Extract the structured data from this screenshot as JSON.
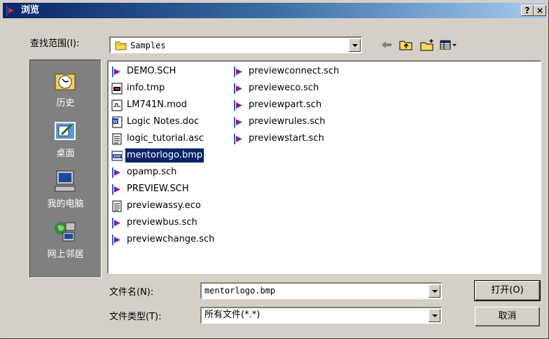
{
  "window": {
    "title": "浏览",
    "help_label": "?",
    "close_label": "×"
  },
  "lookin": {
    "label": "查找范围(I):",
    "value": "Samples"
  },
  "toolbar": [
    "back-icon",
    "up-folder-icon",
    "new-folder-icon",
    "view-menu-icon"
  ],
  "places": [
    {
      "label": "历史",
      "icon": "history-icon"
    },
    {
      "label": "桌面",
      "icon": "desktop-icon"
    },
    {
      "label": "我的电脑",
      "icon": "my-computer-icon"
    },
    {
      "label": "网上邻居",
      "icon": "network-icon"
    }
  ],
  "files": {
    "col1": [
      {
        "name": "DEMO.SCH",
        "icon": "schematic"
      },
      {
        "name": "info.tmp",
        "icon": "tmp"
      },
      {
        "name": "LM741N.mod",
        "icon": "mod"
      },
      {
        "name": "Logic Notes.doc",
        "icon": "word"
      },
      {
        "name": "logic_tutorial.asc",
        "icon": "text"
      },
      {
        "name": "mentorlogo.bmp",
        "icon": "bmp",
        "selected": true
      },
      {
        "name": "opamp.sch",
        "icon": "schematic"
      },
      {
        "name": "PREVIEW.SCH",
        "icon": "schematic"
      },
      {
        "name": "previewassy.eco",
        "icon": "text"
      },
      {
        "name": "previewbus.sch",
        "icon": "schematic"
      },
      {
        "name": "previewchange.sch",
        "icon": "schematic"
      }
    ],
    "col2": [
      {
        "name": "previewconnect.sch",
        "icon": "schematic"
      },
      {
        "name": "previeweco.sch",
        "icon": "schematic"
      },
      {
        "name": "previewpart.sch",
        "icon": "schematic"
      },
      {
        "name": "previewrules.sch",
        "icon": "schematic"
      },
      {
        "name": "previewstart.sch",
        "icon": "schematic"
      }
    ]
  },
  "filename": {
    "label": "文件名(N):",
    "value": "mentorlogo.bmp"
  },
  "filetype": {
    "label": "文件类型(T):",
    "value": "所有文件(*.*)"
  },
  "buttons": {
    "open": "打开(O)",
    "cancel": "取消"
  },
  "colors": {
    "title_start": "#0a246a",
    "title_end": "#a6caf0",
    "face": "#d4d0c8",
    "selection": "#0a246a",
    "sch_icon": "#8a1f8f"
  }
}
